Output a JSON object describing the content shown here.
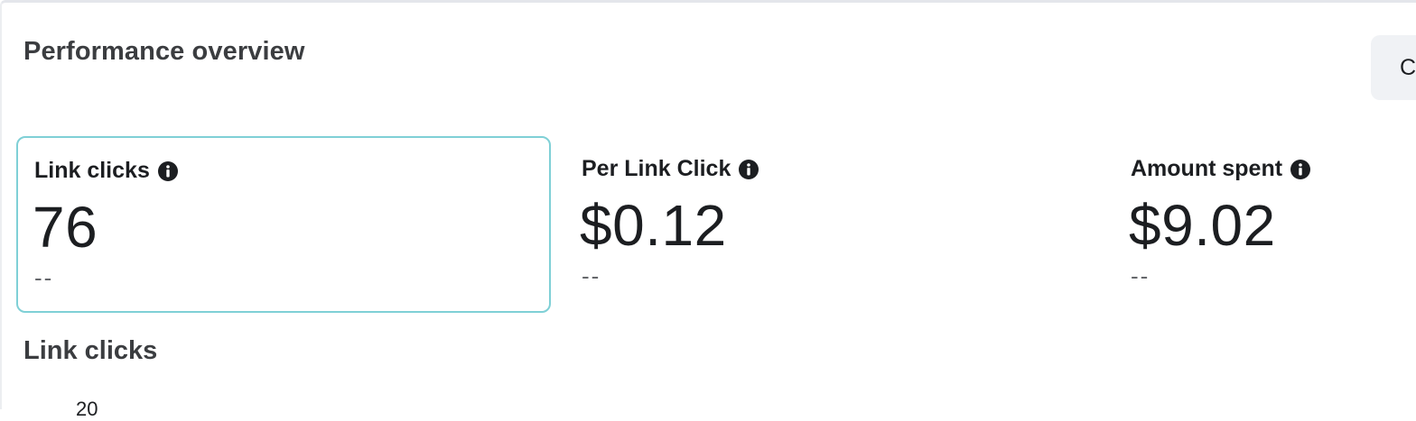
{
  "header": {
    "title": "Performance overview",
    "right_button_label": "C"
  },
  "metrics": [
    {
      "label": "Link clicks",
      "value": "76",
      "change": "--",
      "selected": true
    },
    {
      "label": "Per Link Click",
      "value": "$0.12",
      "change": "--",
      "selected": false
    },
    {
      "label": "Amount spent",
      "value": "$9.02",
      "change": "--",
      "selected": false
    }
  ],
  "chart": {
    "title": "Link clicks",
    "y_tick_top": "20"
  },
  "colors": {
    "selected_border": "#7fd0d6",
    "button_bg": "#f0f2f5",
    "text_primary": "#1c1e21",
    "text_secondary": "#65676b"
  },
  "icons": {
    "info": "info-icon"
  }
}
